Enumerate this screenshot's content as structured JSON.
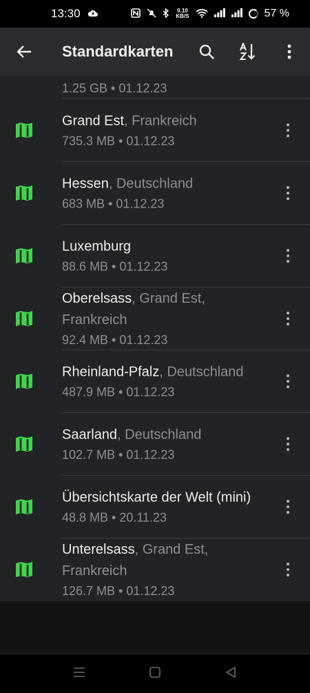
{
  "status_bar": {
    "time": "13:30",
    "speed_value": "0.10",
    "speed_unit": "KB/S",
    "battery": "57 %"
  },
  "app_bar": {
    "title": "Standardkarten"
  },
  "partial_item": {
    "meta": "1.25 GB • 01.12.23"
  },
  "items": [
    {
      "name": "Grand Est",
      "region": ", Frankreich",
      "meta": "735.3 MB • 01.12.23"
    },
    {
      "name": "Hessen",
      "region": ", Deutschland",
      "meta": "683 MB • 01.12.23"
    },
    {
      "name": "Luxemburg",
      "region": "",
      "meta": "88.6 MB • 01.12.23"
    },
    {
      "name": "Oberelsass",
      "region": ", Grand Est, Frankreich",
      "meta": "92.4 MB • 01.12.23"
    },
    {
      "name": "Rheinland-Pfalz",
      "region": ", Deutschland",
      "meta": "487.9 MB • 01.12.23"
    },
    {
      "name": "Saarland",
      "region": ", Deutschland",
      "meta": "102.7 MB • 01.12.23"
    },
    {
      "name": "Übersichtskarte der Welt (mini)",
      "region": "",
      "meta": "48.8 MB • 20.11.23"
    },
    {
      "name": "Unterelsass",
      "region": ", Grand Est, Frankreich",
      "meta": "126.7 MB • 01.12.23"
    }
  ],
  "colors": {
    "accent_green": "#3fd44a",
    "app_bar": "#2a2c2f",
    "list_bg": "#212326"
  },
  "icons": {
    "back": "arrow-left-icon",
    "search": "search-icon",
    "sort": "sort-az-icon",
    "more": "more-vertical-icon",
    "map": "map-icon"
  }
}
